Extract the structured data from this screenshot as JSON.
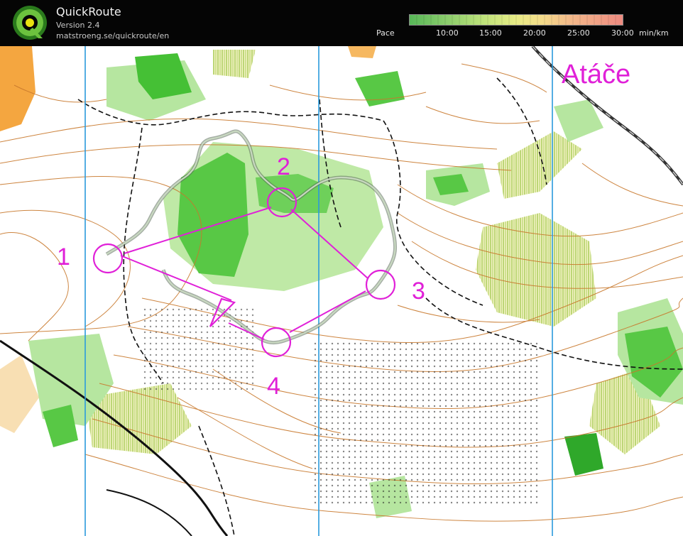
{
  "app": {
    "title": "QuickRoute",
    "version": "Version 2.4",
    "url": "matstroeng.se/quickroute/en",
    "logo_letter": "Q"
  },
  "pace_legend": {
    "label": "Pace",
    "ticks": [
      "10:00",
      "15:00",
      "20:00",
      "25:00",
      "30:00"
    ],
    "unit": "min/km",
    "colors": [
      "#58b858",
      "#bde27a",
      "#e8ec86",
      "#f3b88a",
      "#ee8a80"
    ]
  },
  "map": {
    "title": "Atáče",
    "controls": [
      "1",
      "2",
      "3",
      "4"
    ],
    "course_color": "#e020d8",
    "route_color": "#8a9a8a"
  }
}
